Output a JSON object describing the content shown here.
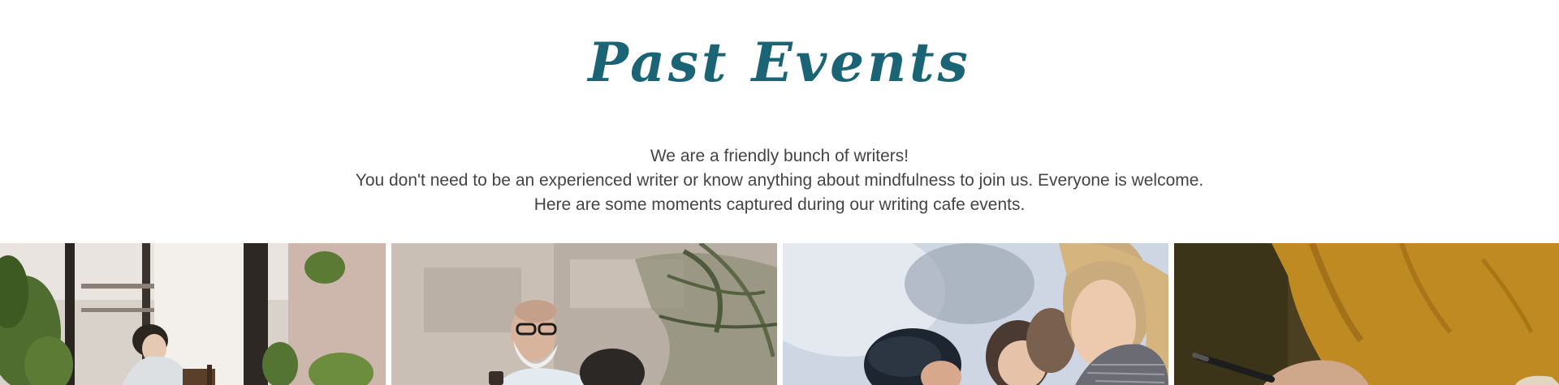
{
  "section": {
    "title": "Past Events",
    "intro_lines": [
      "We are a friendly bunch of writers!",
      "You don't need to be an experienced writer or know anything about mindfulness to join us. Everyone is welcome.",
      "Here are some moments captured during our writing cafe events."
    ]
  },
  "colors": {
    "title": "#1a6475",
    "body_text": "#444444"
  },
  "gallery": {
    "photos": [
      {
        "icon": "photo-woman-writing-cafe"
      },
      {
        "icon": "photo-bearded-man-glasses"
      },
      {
        "icon": "photo-women-chatting"
      },
      {
        "icon": "photo-hands-writing-pen"
      }
    ]
  }
}
